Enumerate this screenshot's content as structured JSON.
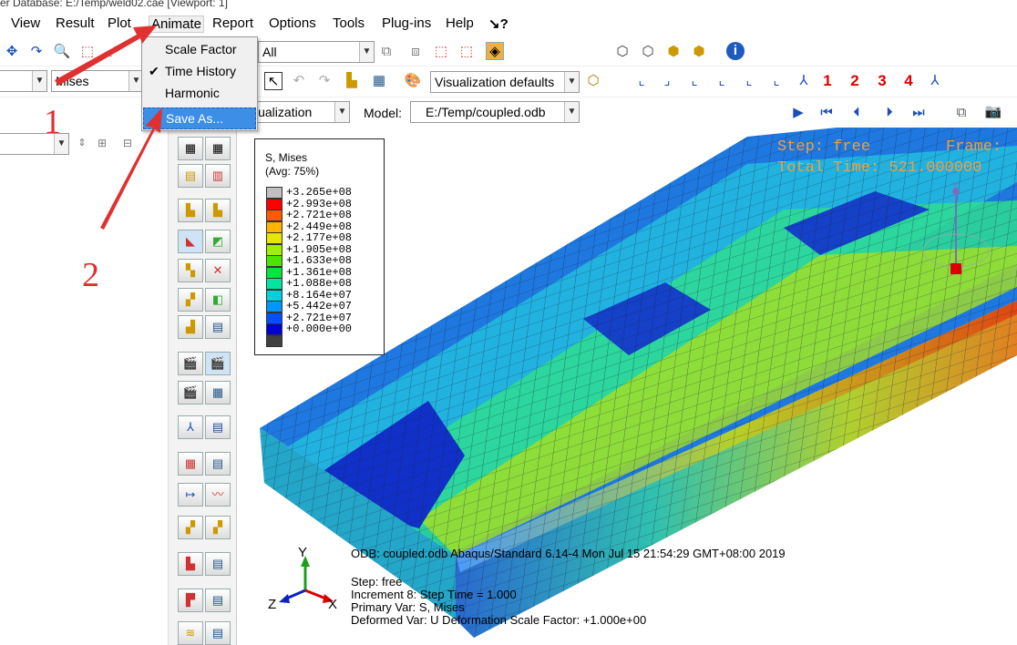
{
  "window": {
    "title": "er Database: E:/Temp/weld02.cae [Viewport: 1]"
  },
  "menubar": {
    "items": [
      "View",
      "Result",
      "Plot",
      "Animate",
      "Report",
      "Options",
      "Tools",
      "Plug-ins",
      "Help",
      "↘?"
    ]
  },
  "animate_menu": {
    "items": [
      {
        "label": "Scale Factor",
        "checked": false,
        "selected": false
      },
      {
        "label": "Time History",
        "checked": true,
        "selected": false
      },
      {
        "label": "Harmonic",
        "checked": false,
        "selected": false
      },
      {
        "label": "Save As...",
        "checked": false,
        "selected": true
      }
    ]
  },
  "toolbar": {
    "all_combo": "All",
    "variable_combo": "Mises",
    "visualization_defaults": "Visualization defaults",
    "module_combo": "isualization",
    "model_label": "Model:",
    "model_combo": "E:/Temp/coupled.odb",
    "view_numbers": [
      "1",
      "2",
      "3",
      "4"
    ]
  },
  "viewport": {
    "step_text": "Step: free",
    "frame_text": "Frame:",
    "total_time_text": "Total Time: 521.000000",
    "axis_y": "Y",
    "axis_x": "X",
    "axis_z": "Z",
    "triad_label": "Y",
    "info": {
      "odb_line": "ODB: coupled.odb    Abaqus/Standard 6.14-4    Mon Jul 15 21:54:29 GMT+08:00 2019",
      "step_line": "Step: free",
      "increment_line": "Increment      8: Step Time =      1.000",
      "primary_line": "Primary Var: S, Mises",
      "deformed_line": "Deformed Var: U   Deformation Scale Factor: +1.000e+00"
    }
  },
  "legend": {
    "title1": "S, Mises",
    "title2": "(Avg: 75%)",
    "entries": [
      {
        "label": "+3.265e+08",
        "color": "#c0c0c0"
      },
      {
        "label": "+2.993e+08",
        "color": "#ff0000"
      },
      {
        "label": "+2.721e+08",
        "color": "#ff5a00"
      },
      {
        "label": "+2.449e+08",
        "color": "#ffb400"
      },
      {
        "label": "+2.177e+08",
        "color": "#e6e600"
      },
      {
        "label": "+1.905e+08",
        "color": "#a0ee00"
      },
      {
        "label": "+1.633e+08",
        "color": "#4ce600"
      },
      {
        "label": "+1.361e+08",
        "color": "#00e640"
      },
      {
        "label": "+1.088e+08",
        "color": "#00e6a0"
      },
      {
        "label": "+8.164e+07",
        "color": "#00d2dc"
      },
      {
        "label": "+5.442e+07",
        "color": "#0096ff"
      },
      {
        "label": "+2.721e+07",
        "color": "#0050ff"
      },
      {
        "label": "+0.000e+00",
        "color": "#0000d2"
      }
    ],
    "bottom_color": "#404040"
  },
  "annotations": {
    "one": "1",
    "two": "2"
  },
  "colors": {
    "highlight": "#3d8ee6",
    "annotation": "#e03030"
  }
}
